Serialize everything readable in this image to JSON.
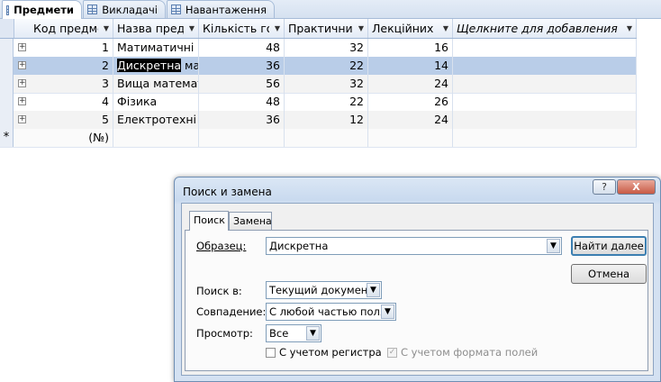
{
  "tabs": [
    {
      "label": "Предмети",
      "active": true
    },
    {
      "label": "Викладачі",
      "active": false
    },
    {
      "label": "Навантаження",
      "active": false
    }
  ],
  "grid": {
    "columns": [
      "Код предме",
      "Назва пред",
      "Кількість го",
      "Практичних",
      "Лекційних",
      "Щелкните для добавления"
    ],
    "rows": [
      {
        "code": "1",
        "name": "Матиматичні",
        "hours": "48",
        "practical": "32",
        "lecture": "16"
      },
      {
        "code": "2",
        "name_hl": "Дискретна",
        "name_rest": " мат",
        "hours": "36",
        "practical": "22",
        "lecture": "14"
      },
      {
        "code": "3",
        "name": "Вища математ",
        "hours": "56",
        "practical": "32",
        "lecture": "24"
      },
      {
        "code": "4",
        "name": "Фізика",
        "hours": "48",
        "practical": "22",
        "lecture": "26"
      },
      {
        "code": "5",
        "name": "Електротехні",
        "hours": "36",
        "practical": "12",
        "lecture": "24"
      }
    ],
    "new_row": {
      "marker": "*",
      "counter": "(№)"
    },
    "expander_glyph": "+"
  },
  "dialog": {
    "title": "Поиск и замена",
    "help_label": "?",
    "close_label": "X",
    "tab_search": "Поиск",
    "tab_replace": "Замена",
    "pattern_label": "Образец:",
    "pattern_value": "Дискретна",
    "find_next_label": "Найти далее",
    "cancel_label": "Отмена",
    "lookin_label": "Поиск в:",
    "lookin_value": "Текущий документ",
    "match_label": "Совпадение:",
    "match_value": "С любой частью поля",
    "search_label": "Просмотр:",
    "search_value": "Все",
    "match_case_label": "С учетом регистра",
    "match_format_label": "С учетом формата полей"
  }
}
